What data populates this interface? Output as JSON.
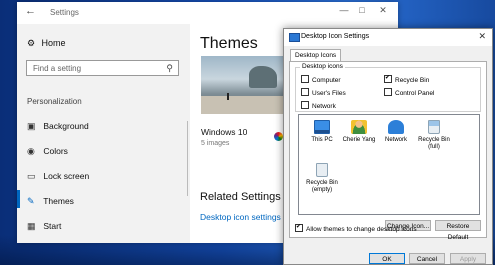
{
  "settings": {
    "window_title": "Settings",
    "home_label": "Home",
    "search_placeholder": "Find a setting",
    "section_label": "Personalization",
    "nav": [
      {
        "label": "Background",
        "icon": "image-icon"
      },
      {
        "label": "Colors",
        "icon": "palette-icon"
      },
      {
        "label": "Lock screen",
        "icon": "monitor-icon"
      },
      {
        "label": "Themes",
        "icon": "brush-icon",
        "selected": true
      },
      {
        "label": "Start",
        "icon": "start-grid-icon"
      }
    ],
    "page_title": "Themes",
    "theme_name": "Windows 10",
    "theme_count": "5 images",
    "related_title": "Related Settings",
    "desktop_icon_link": "Desktop icon settings",
    "accent_color": "#0067c0"
  },
  "dialog": {
    "title": "Desktop Icon Settings",
    "tab": "Desktop Icons",
    "group_label": "Desktop icons",
    "checkboxes": [
      {
        "label": "Computer",
        "checked": false
      },
      {
        "label": "Recycle Bin",
        "checked": true
      },
      {
        "label": "User's Files",
        "checked": false
      },
      {
        "label": "Control Panel",
        "checked": false
      },
      {
        "label": "Network",
        "checked": false
      }
    ],
    "icons": [
      {
        "label": "This PC",
        "icon": "computer-icon"
      },
      {
        "label": "Cherie Yang",
        "icon": "user-folder-icon"
      },
      {
        "label": "Network",
        "icon": "network-icon"
      },
      {
        "label": "Recycle Bin (full)",
        "icon": "recycle-bin-full-icon"
      },
      {
        "label": "Recycle Bin (empty)",
        "icon": "recycle-bin-empty-icon"
      }
    ],
    "change_icon": "Change Icon...",
    "restore_default": "Restore Default",
    "allow_themes": "Allow themes to change desktop icons",
    "allow_themes_checked": true,
    "ok": "OK",
    "cancel": "Cancel",
    "apply": "Apply"
  }
}
